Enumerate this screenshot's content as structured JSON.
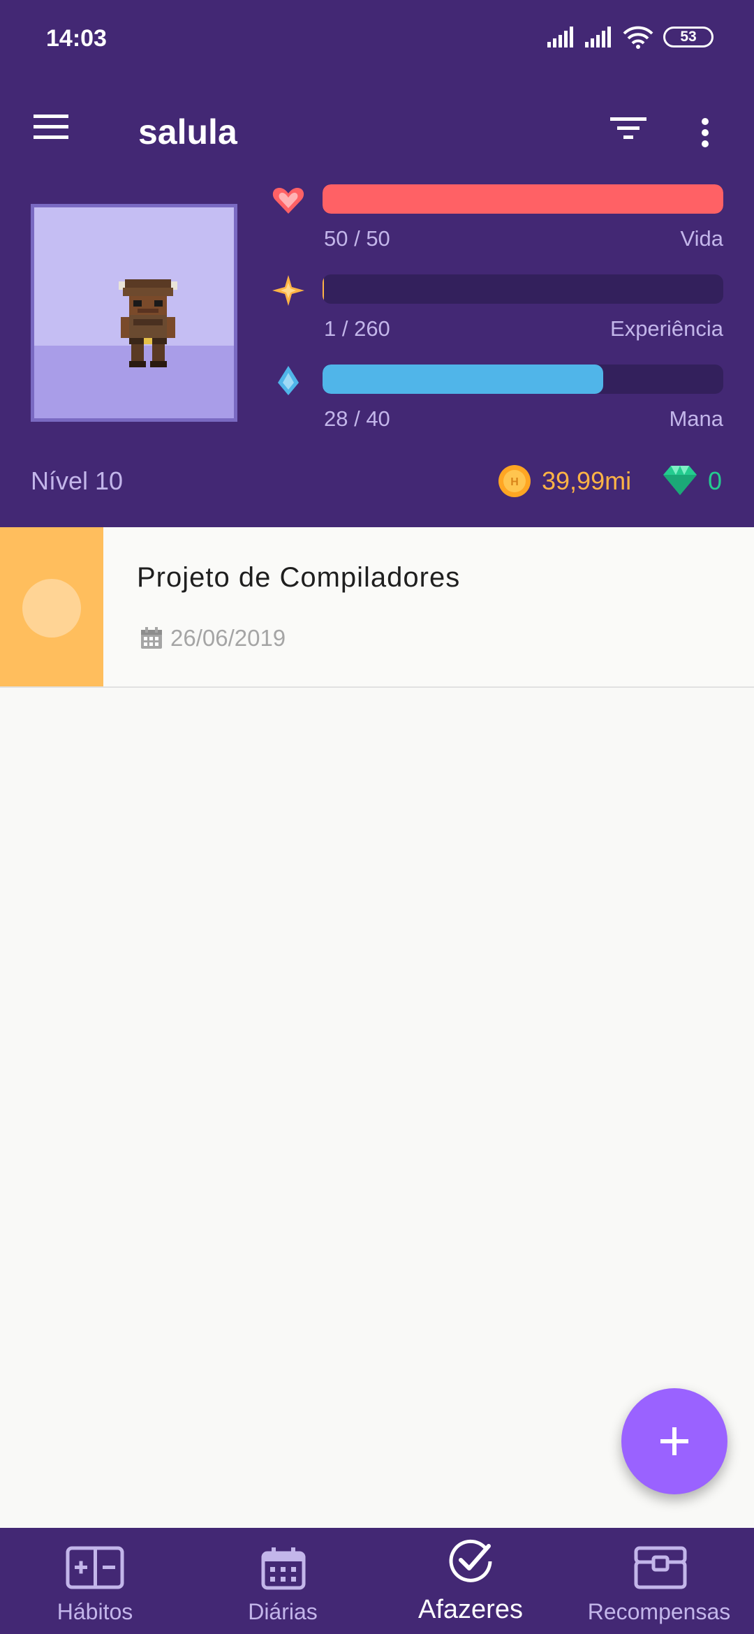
{
  "status_bar": {
    "time": "14:03",
    "battery": "53"
  },
  "toolbar": {
    "title": "salula"
  },
  "stats": {
    "health": {
      "value": "50 / 50",
      "label": "Vida",
      "fraction": 1.0,
      "color": "#ff6165"
    },
    "experience": {
      "value": "1 / 260",
      "label": "Experiência",
      "fraction": 0.004,
      "color": "#ffb445"
    },
    "mana": {
      "value": "28 / 40",
      "label": "Mana",
      "fraction": 0.7,
      "color": "#50b5e9"
    }
  },
  "level": "Nível 10",
  "gold": "39,99mi",
  "gems": "0",
  "tasks": [
    {
      "title": "Projeto de Compiladores",
      "due_date": "26/06/2019",
      "color": "#ffbe5d"
    }
  ],
  "bottom_nav": [
    {
      "label": "Hábitos",
      "icon": "habits-icon",
      "active": false
    },
    {
      "label": "Diárias",
      "icon": "calendar-icon",
      "active": false
    },
    {
      "label": "Afazeres",
      "icon": "check-circle-icon",
      "active": true
    },
    {
      "label": "Recompensas",
      "icon": "chest-icon",
      "active": false
    }
  ],
  "colors": {
    "header": "#432874",
    "accent": "#9a62ff"
  }
}
